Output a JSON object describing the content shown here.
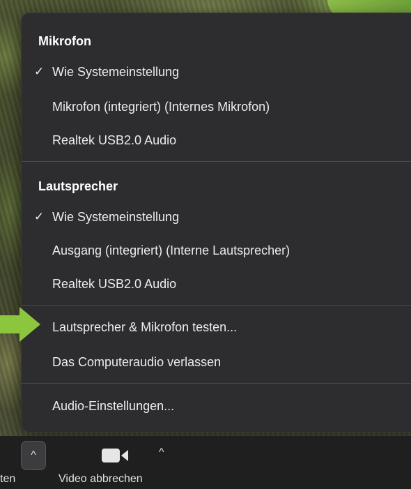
{
  "menu": {
    "sections": [
      {
        "title": "Mikrofon",
        "items": [
          {
            "label": "Wie Systemeinstellung",
            "checked": "✓"
          },
          {
            "label": "Mikrofon (integriert) (Internes Mikrofon)",
            "checked": ""
          },
          {
            "label": "Realtek USB2.0 Audio",
            "checked": ""
          }
        ]
      },
      {
        "title": "Lautsprecher",
        "items": [
          {
            "label": "Wie Systemeinstellung",
            "checked": "✓"
          },
          {
            "label": "Ausgang (integriert) (Interne Lautsprecher)",
            "checked": ""
          },
          {
            "label": "Realtek USB2.0 Audio",
            "checked": ""
          }
        ]
      }
    ],
    "actions": {
      "test": "Lautsprecher & Mikrofon testen...",
      "leave": "Das Computeraudio verlassen",
      "settings": "Audio-Einstellungen..."
    }
  },
  "toolbar": {
    "left_label": "ten",
    "video_label": "Video abbrechen",
    "caret_symbol": "^",
    "video_caret_symbol": "^"
  },
  "colors": {
    "menu_bg": "#2d2d2f",
    "arrow": "#8cc63f"
  },
  "icons": {
    "arrow": "green-arrow-icon",
    "video": "video-camera-icon",
    "check": "checkmark-icon"
  }
}
